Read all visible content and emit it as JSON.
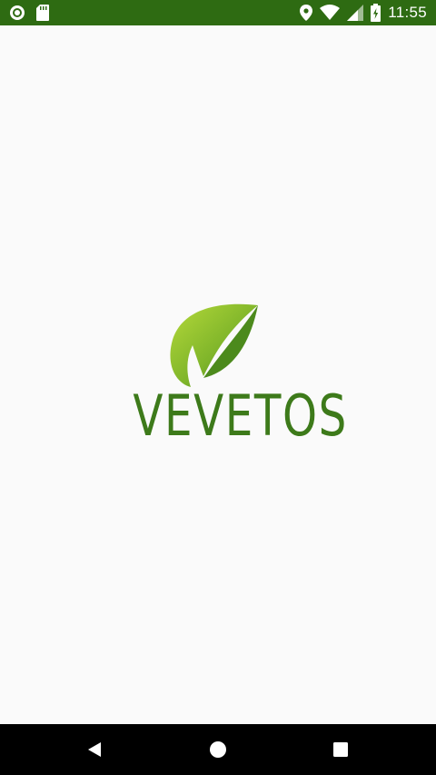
{
  "status_bar": {
    "time": "11:55",
    "background_color": "#2e6b12",
    "icons_left": [
      "notification-circle-icon",
      "sd-card-icon"
    ],
    "icons_right": [
      "location-pin-icon",
      "wifi-icon",
      "cell-signal-icon",
      "battery-charging-icon"
    ]
  },
  "splash": {
    "brand_name": "VEVETOS",
    "brand_color": "#3d7a1a",
    "logo_icon": "leaf-logo-icon",
    "background_color": "#fafafa"
  },
  "nav_bar": {
    "buttons": [
      "back-icon",
      "home-icon",
      "recents-icon"
    ]
  }
}
